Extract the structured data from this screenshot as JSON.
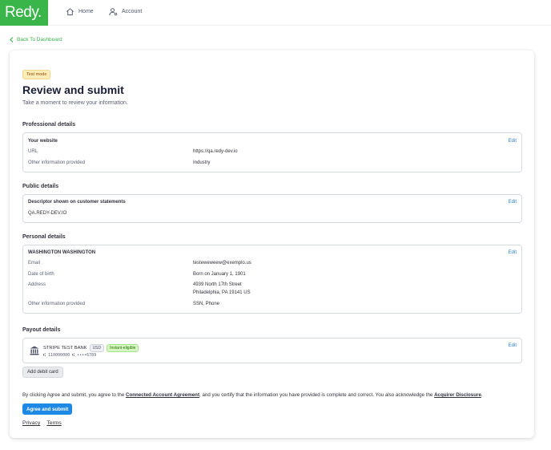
{
  "nav": {
    "logo": "Redy.",
    "home": "Home",
    "account": "Account"
  },
  "back_link": "Back To Dashboard",
  "card": {
    "badge": "Test mode",
    "title": "Review and submit",
    "subtitle": "Take a moment to review your information."
  },
  "professional": {
    "section": "Professional details",
    "heading": "Your website",
    "edit": "Edit",
    "rows": [
      {
        "label": "URL",
        "value": "https://qa.redy-dev.io"
      },
      {
        "label": "Other information provided",
        "value": "Industry"
      }
    ]
  },
  "public": {
    "section": "Public details",
    "heading": "Descriptor shown on customer statements",
    "edit": "Edit",
    "descriptor": "QA.REDY-DEV.IO"
  },
  "personal": {
    "section": "Personal details",
    "heading": "WASHINGTON WASHINGTON",
    "edit": "Edit",
    "rows": [
      {
        "label": "Email",
        "value": "testeweweew@exemplo.us"
      },
      {
        "label": "Date of birth",
        "value": "Born on January 1, 1901"
      },
      {
        "label": "Address",
        "value": "4939 North 17th Street",
        "value2": "Philadelphia, PA 19141 US"
      },
      {
        "label": "Other information provided",
        "value": "SSN, Phone"
      }
    ]
  },
  "payout": {
    "section": "Payout details",
    "bank_name": "STRIPE TEST BANK",
    "currency": "USD",
    "eligibility": "Instant-eligible",
    "account_number": "⑆ 110000000 ⑆ ••••6789",
    "edit": "Edit",
    "add_debit": "Add debit card"
  },
  "legal": {
    "part1": "By clicking Agree and submit, you agree to the ",
    "link1": "Connected Account Agreement",
    "part2": ", and you certify that the information you have provided is complete and correct. You also acknowledge the ",
    "link2": "Acquirer Disclosure",
    "part3": "."
  },
  "submit_label": "Agree and submit",
  "footer": {
    "privacy": "Privacy",
    "terms": "Terms"
  },
  "colors": {
    "brand": "#3ab54a",
    "primary_button": "#1e88e5",
    "link": "#2a7fd4"
  }
}
